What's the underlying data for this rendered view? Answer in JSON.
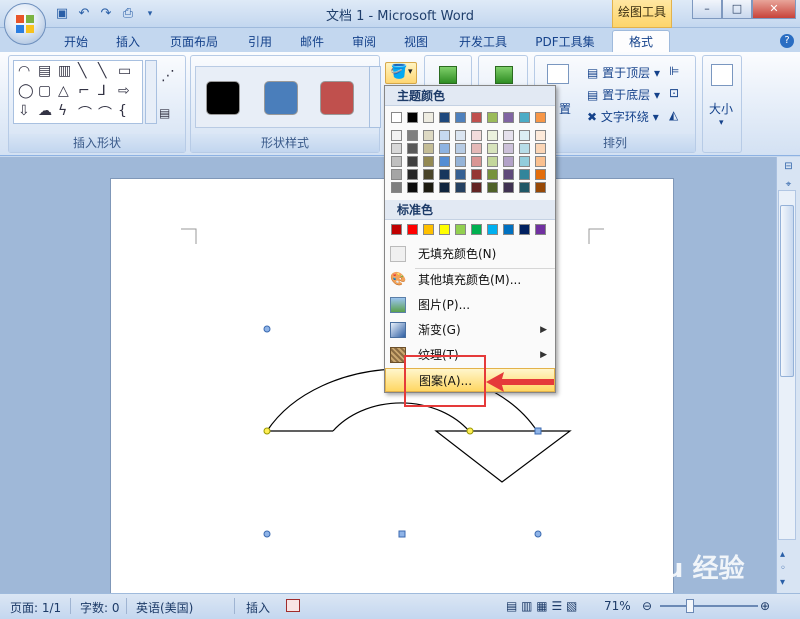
{
  "app": {
    "title": "文档 1 - Microsoft Word",
    "contextual_tab": "绘图工具"
  },
  "window_controls": {
    "minimize": "–",
    "maximize": "□",
    "close": "✕"
  },
  "tabs": [
    {
      "label": "开始"
    },
    {
      "label": "插入"
    },
    {
      "label": "页面布局"
    },
    {
      "label": "引用"
    },
    {
      "label": "邮件"
    },
    {
      "label": "审阅"
    },
    {
      "label": "视图"
    },
    {
      "label": "开发工具"
    },
    {
      "label": "PDF工具集"
    },
    {
      "label": "格式",
      "active": true
    }
  ],
  "ribbon": {
    "group_insert_shapes": "插入形状",
    "group_shape_styles": "形状样式",
    "group_arrange": "排列",
    "bring_front": "置于顶层",
    "send_back": "置于底层",
    "text_wrap": "文字环绕",
    "position_partial": "置",
    "size": "大小",
    "style_swatches": [
      "#000000",
      "#4a7ebb",
      "#c0504d"
    ]
  },
  "fill_menu": {
    "theme_colors_header": "主题颜色",
    "standard_colors_header": "标准色",
    "theme_top_row": [
      "#ffffff",
      "#000000",
      "#eeece1",
      "#1f497d",
      "#4f81bd",
      "#c0504d",
      "#9bbb59",
      "#8064a2",
      "#4bacc6",
      "#f79646"
    ],
    "theme_shades": [
      [
        "#f2f2f2",
        "#d8d8d8",
        "#bfbfbf",
        "#a5a5a5",
        "#7f7f7f"
      ],
      [
        "#7f7f7f",
        "#595959",
        "#3f3f3f",
        "#262626",
        "#0c0c0c"
      ],
      [
        "#ddd9c3",
        "#c4bd97",
        "#938953",
        "#494429",
        "#1d1b10"
      ],
      [
        "#c6d9f0",
        "#8db3e2",
        "#548dd4",
        "#17365d",
        "#0f243e"
      ],
      [
        "#dbe5f1",
        "#b8cce4",
        "#95b3d7",
        "#366092",
        "#244061"
      ],
      [
        "#f2dcdb",
        "#e5b9b7",
        "#d99694",
        "#953734",
        "#632423"
      ],
      [
        "#ebf1dd",
        "#d7e3bc",
        "#c3d69b",
        "#76923c",
        "#4f6128"
      ],
      [
        "#e5e0ec",
        "#ccc1d9",
        "#b2a2c7",
        "#5f497a",
        "#3f3151"
      ],
      [
        "#dbeef3",
        "#b7dde8",
        "#92cddc",
        "#31859b",
        "#205867"
      ],
      [
        "#fdeada",
        "#fbd5b5",
        "#fac08f",
        "#e36c09",
        "#974806"
      ]
    ],
    "standard_colors": [
      "#c00000",
      "#ff0000",
      "#ffc000",
      "#ffff00",
      "#92d050",
      "#00b050",
      "#00b0f0",
      "#0070c0",
      "#002060",
      "#7030a0"
    ],
    "items": {
      "no_fill": "无填充颜色(N)",
      "more_colors": "其他填充颜色(M)...",
      "picture": "图片(P)...",
      "gradient": "渐变(G)",
      "texture": "纹理(T)",
      "pattern": "图案(A)..."
    }
  },
  "status": {
    "page": "页面: 1/1",
    "words": "字数: 0",
    "language": "英语(美国)",
    "mode": "插入",
    "zoom": "71%"
  },
  "watermark": "Baidu 经验"
}
